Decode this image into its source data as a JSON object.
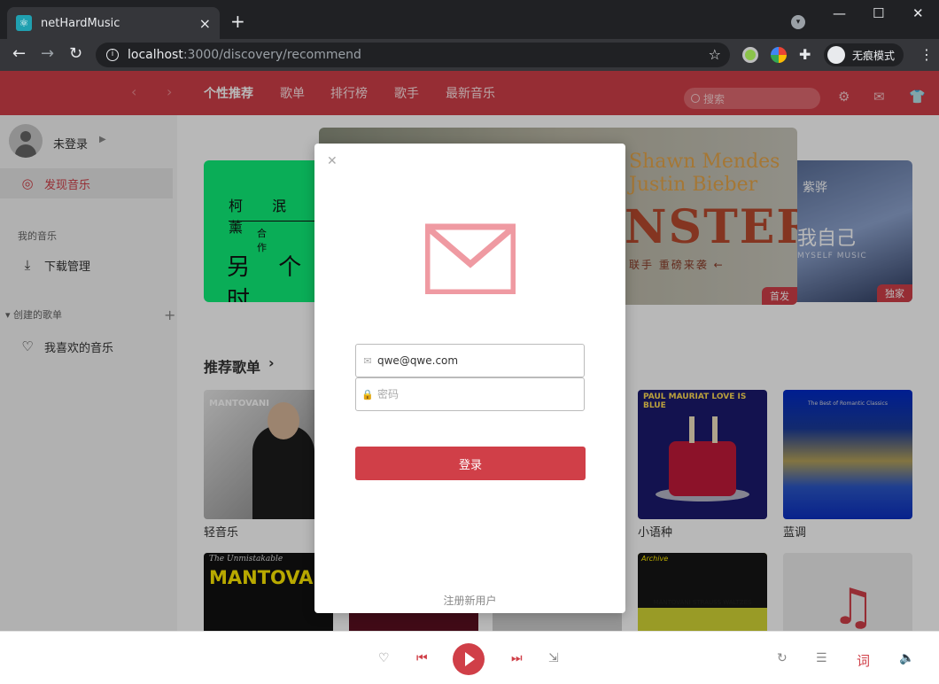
{
  "browser": {
    "tab_title": "netHardMusic",
    "url_host": "localhost",
    "url_path": ":3000/discovery/recommend",
    "incognito_label": "无痕模式"
  },
  "header": {
    "nav": [
      "个性推荐",
      "歌单",
      "排行榜",
      "歌手",
      "最新音乐"
    ],
    "search_placeholder": "搜索"
  },
  "sidebar": {
    "login_text": "未登录",
    "discover": "发现音乐",
    "my_music_section": "我的音乐",
    "download": "下载管理",
    "created_section": "创建的歌单",
    "favorite": "我喜欢的音乐"
  },
  "banners": {
    "left_line1": "柯 泯 薰",
    "left_line2": "合 作",
    "left_line3": "另 个 时",
    "center_name1": "Shawn Mendes",
    "center_name2": "Justin Bieber",
    "center_big": "NSTER",
    "center_sub": "联手 重磅来袭 ←",
    "center_badge": "首发",
    "right_line1": "紫骅",
    "right_line2": "我自己",
    "right_line3": "MYSELF MUSIC",
    "right_badge": "独家"
  },
  "recommend": {
    "title": "推荐歌单",
    "cards": [
      {
        "name": "轻音乐",
        "cover_text": "MANTOVANI"
      },
      {
        "name": "小语种",
        "cover_text": "PAUL MAURIAT LOVE IS BLUE"
      },
      {
        "name": "蓝调",
        "cover_text": "The Best of Romantic Classics"
      }
    ],
    "row2": {
      "a_line1": "The Unmistakable",
      "a_line2": "MANTOVANI",
      "d_line1": "Archive",
      "d_line2": "MANTOVANI STRAUSS WALTZES"
    }
  },
  "login_modal": {
    "email_value": "qwe@qwe.com",
    "password_placeholder": "密码",
    "login_button": "登录",
    "register_link": "注册新用户"
  },
  "player": {
    "lyric_label": "词"
  },
  "colors": {
    "brand": "#d03f48"
  }
}
